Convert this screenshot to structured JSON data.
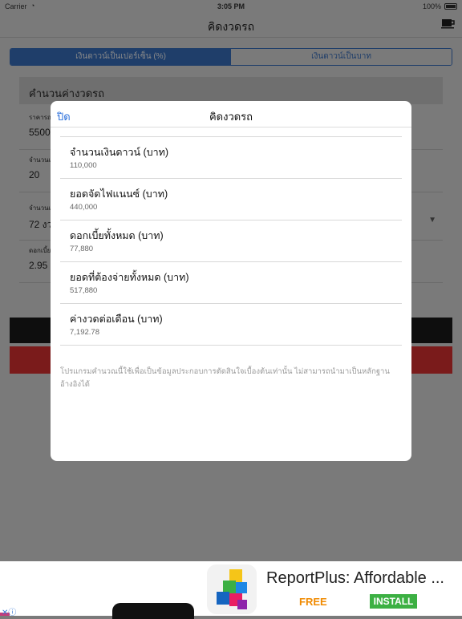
{
  "status_bar": {
    "carrier": "Carrier",
    "time": "3:05 PM",
    "battery": "100%"
  },
  "nav": {
    "title": "คิดงวดรถ"
  },
  "segmented": [
    {
      "label": "เงินดาวน์เป็นเปอร์เซ็น (%)"
    },
    {
      "label": "เงินดาวน์เป็นบาท"
    }
  ],
  "form": {
    "section_title": "คำนวนค่างวดรถ",
    "fields": [
      {
        "label": "ราคารถ",
        "value": "5500"
      },
      {
        "label": "จำนวนเ",
        "value": "20"
      },
      {
        "label": "จำนวนเ",
        "value": "72 งว"
      },
      {
        "label": "ดอกเบี้ย",
        "value": "2.95"
      }
    ]
  },
  "modal": {
    "close_label": "ปิด",
    "title": "คิดงวดรถ",
    "results": [
      {
        "label": "จำนวนเงินดาวน์ (บาท)",
        "value": "110,000"
      },
      {
        "label": "ยอดจัดไฟแนนซ์ (บาท)",
        "value": "440,000"
      },
      {
        "label": "ดอกเบี้ยทั้งหมด (บาท)",
        "value": "77,880"
      },
      {
        "label": "ยอดที่ต้องจ่ายทั้งหมด (บาท)",
        "value": "517,880"
      },
      {
        "label": "ค่างวดต่อเดือน (บาท)",
        "value": "7,192.78"
      }
    ],
    "disclaimer": "โปรแกรมคำนวณนี้ใช้เพื่อเป็นข้อมูลประกอบการตัดสินใจเบื้องต้นเท่านั้น ไม่สามารถนำมาเป็นหลักฐานอ้างอิงได้"
  },
  "ad": {
    "title": "ReportPlus: Affordable ...",
    "free": "FREE",
    "install": "INSTALL"
  },
  "colors": {
    "accent": "#2a6fdb",
    "install_green": "#3cb043",
    "free_orange": "#f08a00"
  }
}
